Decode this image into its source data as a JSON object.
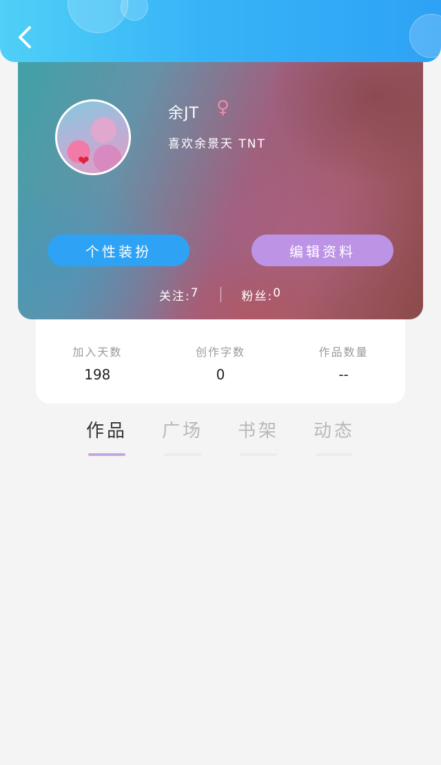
{
  "header": {
    "back_icon": "chevron-left-icon"
  },
  "profile": {
    "username": "余JT",
    "gender_icon": "♀",
    "bio": "喜欢余景天 TNT",
    "buttons": {
      "dress_up": "个性装扮",
      "edit_profile": "编辑资料"
    },
    "follow_label": "关注:",
    "follow_count": "7",
    "fans_label": "粉丝:",
    "fans_count": "0"
  },
  "stats": [
    {
      "label": "加入天数",
      "value": "198"
    },
    {
      "label": "创作字数",
      "value": "0"
    },
    {
      "label": "作品数量",
      "value": "--"
    }
  ],
  "tabs": [
    {
      "label": "作品",
      "active": true
    },
    {
      "label": "广场",
      "active": false
    },
    {
      "label": "书架",
      "active": false
    },
    {
      "label": "动态",
      "active": false
    }
  ],
  "colors": {
    "topbar": "#37b4f7",
    "dress_button": "#2ea3f5",
    "edit_button": "#bd93e6",
    "tab_indicator": "#c4a6e0",
    "gender": "#f08aa6"
  }
}
